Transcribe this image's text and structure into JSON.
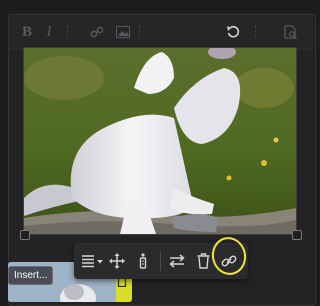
{
  "insert_thumbnail": {
    "label": "Insert..."
  },
  "colors": {
    "background": "#1d1d1f",
    "toolbar_bg": "#262628",
    "image_toolbar_bg": "#2b2b2e",
    "highlight": "#f0e633",
    "icon_dim": "#5a5a5e",
    "icon_light": "#d4d4d6"
  },
  "main_toolbar": {
    "icons": [
      "bold-icon",
      "italic-icon",
      "more-options-icon",
      "link-icon",
      "image-icon",
      "more-options-icon",
      "undo-icon",
      "more-options-icon",
      "preview-icon"
    ],
    "bold_glyph": "B",
    "italic_glyph": "I"
  },
  "image_toolbar": {
    "icons": [
      "align-icon",
      "move-icon",
      "alt-text-icon",
      "replace-icon",
      "delete-icon",
      "link-icon"
    ]
  }
}
